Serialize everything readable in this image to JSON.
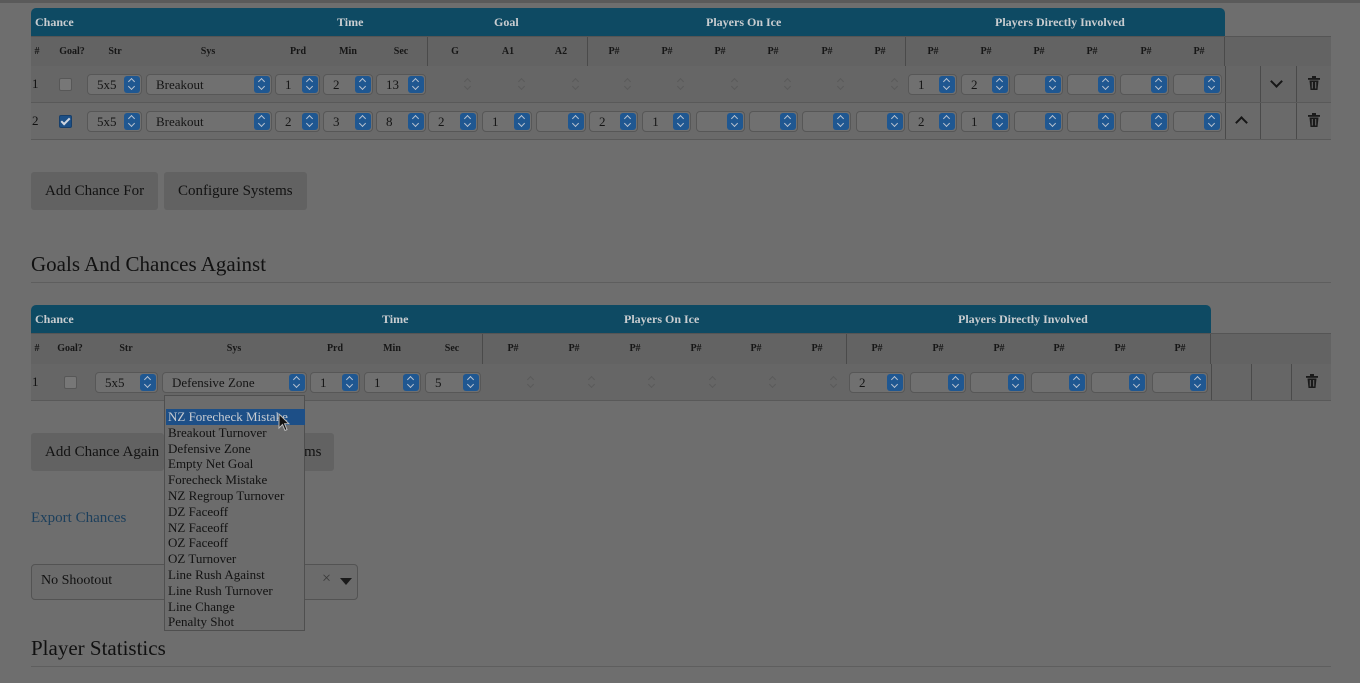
{
  "for_table": {
    "groups": [
      "Chance",
      "Time",
      "Goal",
      "Players On Ice",
      "Players Directly Involved"
    ],
    "columns": [
      "#",
      "Goal?",
      "Str",
      "Sys",
      "Prd",
      "Min",
      "Sec",
      "G",
      "A1",
      "A2",
      "P#",
      "P#",
      "P#",
      "P#",
      "P#",
      "P#",
      "P#",
      "P#",
      "P#",
      "P#",
      "P#",
      "P#"
    ],
    "rows": [
      {
        "num": "1",
        "goal": false,
        "str": "5x5",
        "sys": "Breakout",
        "prd": "1",
        "min": "2",
        "sec": "13",
        "g": "",
        "a1": "",
        "a2": "",
        "on_ice": [
          "",
          "",
          "",
          "",
          "",
          ""
        ],
        "involved": [
          "1",
          "2",
          "",
          "",
          "",
          ""
        ]
      },
      {
        "num": "2",
        "goal": true,
        "str": "5x5",
        "sys": "Breakout",
        "prd": "2",
        "min": "3",
        "sec": "8",
        "g": "2",
        "a1": "1",
        "a2": "",
        "on_ice": [
          "2",
          "1",
          "",
          "",
          "",
          ""
        ],
        "involved": [
          "2",
          "1",
          "",
          "",
          "",
          ""
        ]
      }
    ]
  },
  "for_buttons": {
    "add": "Add Chance For",
    "configure": "Configure Systems"
  },
  "against_heading": "Goals And Chances Against",
  "against_table": {
    "groups": [
      "Chance",
      "Time",
      "Players On Ice",
      "Players Directly Involved"
    ],
    "columns": [
      "#",
      "Goal?",
      "Str",
      "Sys",
      "Prd",
      "Min",
      "Sec",
      "P#",
      "P#",
      "P#",
      "P#",
      "P#",
      "P#",
      "P#",
      "P#",
      "P#",
      "P#",
      "P#",
      "P#"
    ],
    "rows": [
      {
        "num": "1",
        "goal": false,
        "str": "5x5",
        "sys": "Defensive Zone",
        "prd": "1",
        "min": "1",
        "sec": "5",
        "on_ice": [
          "",
          "",
          "",
          "",
          "",
          ""
        ],
        "involved": [
          "2",
          "",
          "",
          "",
          "",
          ""
        ]
      }
    ]
  },
  "against_buttons": {
    "add": "Add Chance Again",
    "configure_tail": "ms"
  },
  "export_link": "Export Chances",
  "shootout": {
    "value": "No Shootout",
    "clear": "×"
  },
  "player_stats_heading": "Player Statistics",
  "sys_dropdown": {
    "highlighted": "NZ Forecheck Mistake",
    "options": [
      "NZ Forecheck Mistake",
      "Breakout Turnover",
      "Defensive Zone",
      "Empty Net Goal",
      "Forecheck Mistake",
      "NZ Regroup Turnover",
      "DZ Faceoff",
      "NZ Faceoff",
      "OZ Faceoff",
      "OZ Turnover",
      "Line Rush Against",
      "Line Rush Turnover",
      "Line Change",
      "Penalty Shot"
    ]
  },
  "icons": {
    "collapse": "chevron-down-icon",
    "expand": "chevron-up-icon",
    "delete": "trash-icon",
    "cursor": "mouse-pointer-icon"
  },
  "colors": {
    "header": "#0e4a63",
    "select_arrow": "#1f5791",
    "highlight": "#1d4f87"
  }
}
